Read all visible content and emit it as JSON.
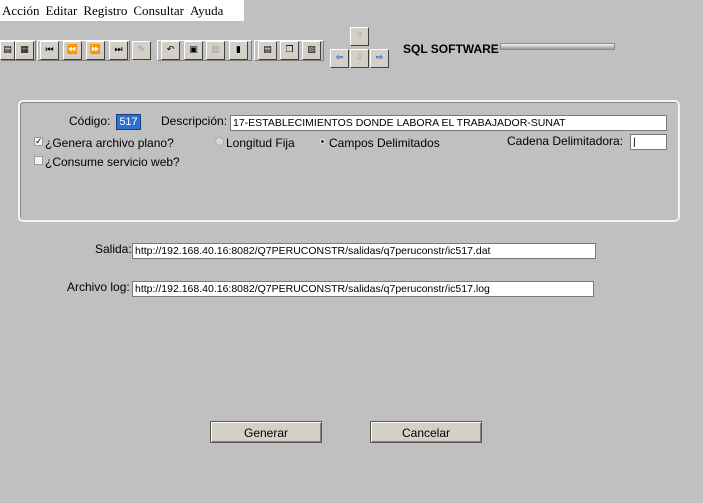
{
  "menu": [
    "Acción",
    "Editar",
    "Registro",
    "Consultar",
    "Ayuda"
  ],
  "toolbar": {
    "product_name": "SQL SOFTWARE"
  },
  "form": {
    "codigo_label": "Código:",
    "codigo_value": "517",
    "descripcion_label": "Descripción:",
    "descripcion_value": "17-ESTABLECIMIENTOS DONDE LABORA EL TRABAJADOR-SUNAT",
    "genera_label": "¿Genera archivo plano?",
    "genera_checked": true,
    "longitud_label": "Longitud Fija",
    "campos_label": "Campos Delimitados",
    "selected_format": "Campos Delimitados",
    "cadena_label": "Cadena Delimitadora:",
    "cadena_value": "|",
    "consume_label": "¿Consume servicio web?",
    "consume_checked": false,
    "salida_label": "Salida:",
    "salida_value": "http://192.168.40.16:8082/Q7PERUCONSTR/salidas/q7peruconstr/ic517.dat",
    "log_label": "Archivo log:",
    "log_value": "http://192.168.40.16:8082/Q7PERUCONSTR/salidas/q7peruconstr/ic517.log"
  },
  "buttons": {
    "generar": "Generar",
    "cancelar": "Cancelar"
  },
  "colors": {
    "background": "#c0c0c0",
    "codigo_highlight": "#2f6fd0"
  }
}
